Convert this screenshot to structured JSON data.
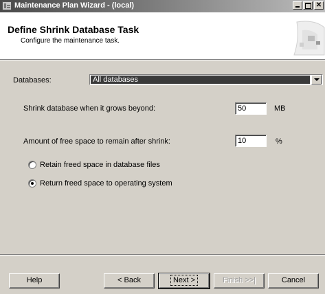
{
  "window": {
    "title": "Maintenance Plan Wizard - (local)"
  },
  "titlebar_buttons": {
    "minimize": "minimize-icon",
    "maximize": "maximize-icon",
    "close": "close-icon"
  },
  "header": {
    "title": "Define Shrink Database Task",
    "subtitle": "Configure the maintenance task."
  },
  "form": {
    "databases_label": "Databases:",
    "databases_value": "All databases",
    "shrink_label": "Shrink database when it grows beyond:",
    "shrink_value": "50",
    "shrink_unit": "MB",
    "free_space_label": "Amount of free space to remain after shrink:",
    "free_space_value": "10",
    "free_space_unit": "%",
    "radio_options": [
      {
        "label": "Retain freed space in database files",
        "selected": false
      },
      {
        "label": "Return freed space to operating system",
        "selected": true
      }
    ]
  },
  "buttons": {
    "help": "Help",
    "back": "< Back",
    "next": "Next >",
    "finish": "Finish >>|",
    "cancel": "Cancel"
  }
}
